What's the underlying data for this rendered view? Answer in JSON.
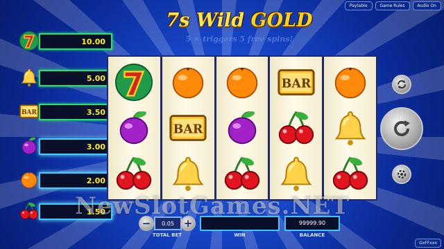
{
  "topbar": {
    "paytable": "Paytable",
    "rules": "Game Rules",
    "audio": "Audio On"
  },
  "title": {
    "main": "7s Wild",
    "gold": "GOLD",
    "subtitle": "5 × triggers 5 free spins!"
  },
  "paytable": [
    {
      "symbol": "seven",
      "value": "10.00"
    },
    {
      "symbol": "bell",
      "value": "5.00"
    },
    {
      "symbol": "bar",
      "value": "3.50"
    },
    {
      "symbol": "plum",
      "value": "3.00"
    },
    {
      "symbol": "orange",
      "value": "2.00"
    },
    {
      "symbol": "cherry",
      "value": "1.50"
    }
  ],
  "reels": [
    [
      "seven",
      "plum",
      "cherry"
    ],
    [
      "orange",
      "bar",
      "bell"
    ],
    [
      "orange",
      "plum",
      "cherry"
    ],
    [
      "bar",
      "cherry",
      "bell"
    ],
    [
      "orange",
      "bell",
      "cherry"
    ]
  ],
  "bar_label": "BAR",
  "bottom": {
    "minus": "−",
    "plus": "+",
    "bet": "0.05",
    "total_bet_label": "TOTAL BET",
    "win": "",
    "win_label": "WIN",
    "balance": "99999.90",
    "balance_label": "BALANCE"
  },
  "watermark": "NewSlotGames.NET",
  "fullscreen": "GxFFxxx",
  "colors": {
    "accent": "#27e36b",
    "gold": "#ffd21c",
    "field_border": "#3ec7ff",
    "pay_value": "#ffef1a"
  }
}
